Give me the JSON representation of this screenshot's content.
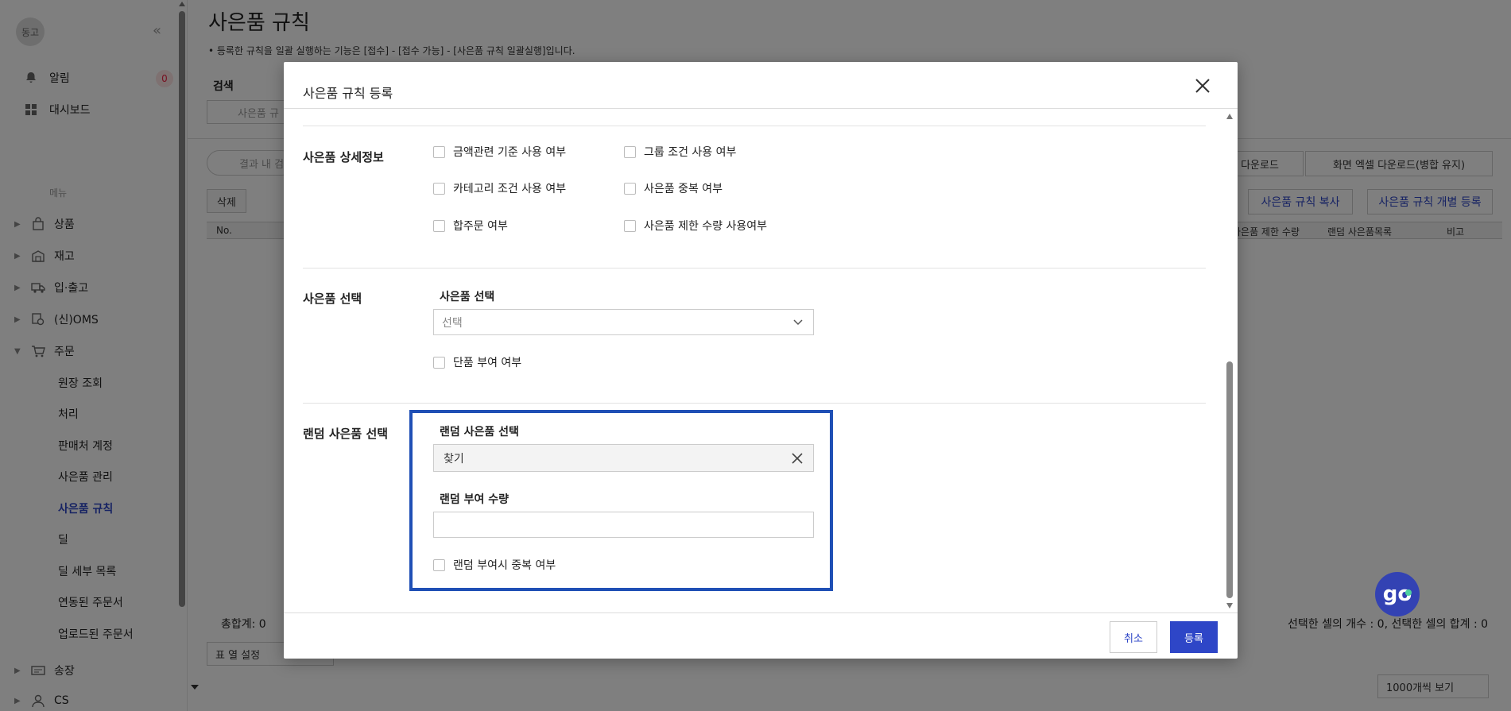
{
  "sidebar": {
    "brand": "동고",
    "notice_label": "알림",
    "notice_count": "0",
    "dashboard_label": "대시보드",
    "menu_title": "메뉴",
    "nav": [
      "상품",
      "재고",
      "입·출고",
      "(신)OMS",
      "주문"
    ],
    "order_sub": [
      "원장 조회",
      "처리",
      "판매처 계정",
      "사은품 관리",
      "사은품 규칙",
      "딜",
      "딜 세부 목록",
      "연동된 주문서",
      "업로드된 주문서"
    ],
    "nav_bottom": [
      "송장",
      "CS"
    ]
  },
  "main": {
    "title": "사은품 규칙",
    "note": "• 등록한 규칙을 일괄 실행하는 기능은 [접수] - [접수 가능] - [사은품 규칙 일괄실행]입니다.",
    "search_label": "검색",
    "search_placeholder": "사은품 규",
    "inner_search_placeholder": "결과 내 검",
    "delete_button": "삭제",
    "download_button": "다운로드",
    "excel_button": "화면 엑셀 다운로드(병합 유지)",
    "copy_button": "사은품 규칙 복사",
    "individual_button": "사은품 규칙 개별 등록",
    "columns": [
      "No.",
      "사은품 제한 수량",
      "랜덤 사은품목록",
      "비고"
    ],
    "total": "총합계: 0",
    "selection_summary": "선택한 셀의 개수 : 0, 선택한 셀의 합계 : 0",
    "column_settings": "표 열 설정",
    "page_size": "1000개씩 보기"
  },
  "modal": {
    "title": "사은품 규칙 등록",
    "detail_section": {
      "label": "사은품 상세정보",
      "options": [
        "금액관련 기준 사용 여부",
        "그룹 조건 사용 여부",
        "카테고리 조건 사용 여부",
        "사은품 중복 여부",
        "합주문 여부",
        "사은품 제한 수량 사용여부"
      ]
    },
    "select_section": {
      "label": "사은품 선택",
      "field_label": "사은품 선택",
      "select_value": "선택",
      "single_option": "단품 부여 여부"
    },
    "random_section": {
      "label": "랜덤 사은품 선택",
      "field_label": "랜덤 사은품 선택",
      "search_value": "찾기",
      "qty_label": "랜덤 부여 수량",
      "qty_value": "",
      "dup_option": "랜덤 부여시 중복 여부"
    },
    "cancel_button": "취소",
    "submit_button": "등록"
  },
  "fab": "go",
  "colors": {
    "accent": "#2e46c7",
    "highlight": "#1f4fb5",
    "overlay": "rgba(0,0,0,0.5)"
  }
}
